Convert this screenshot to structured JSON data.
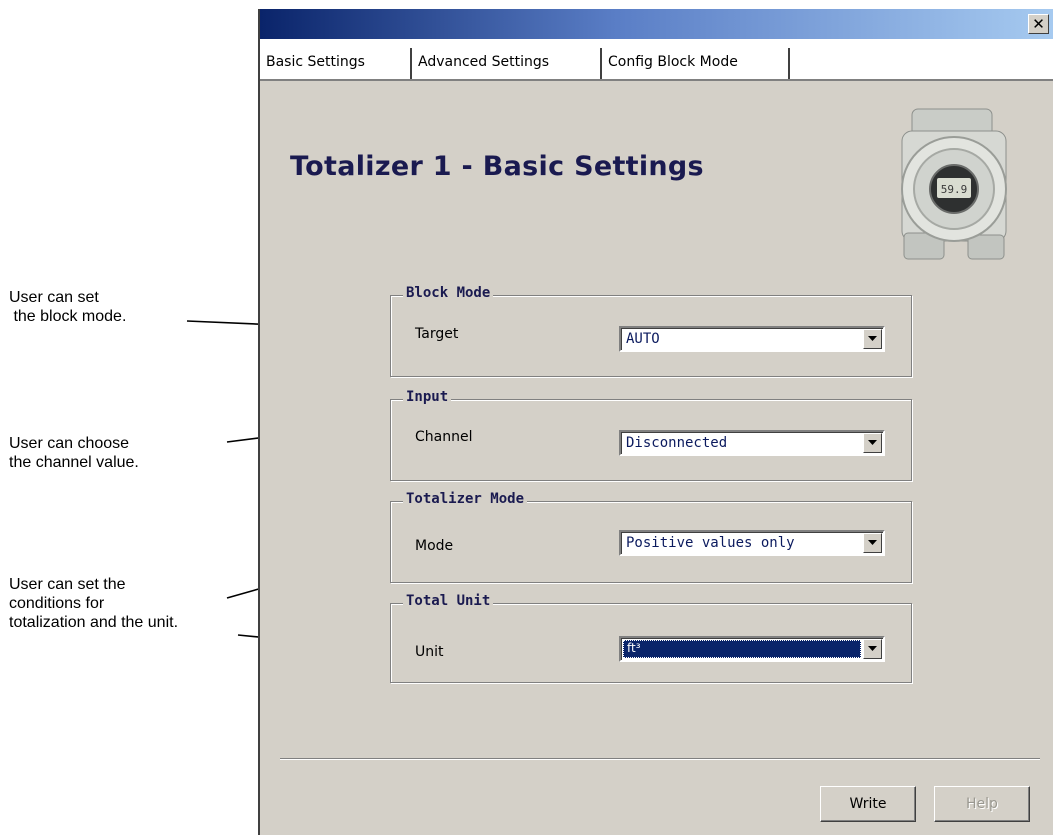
{
  "annotations": {
    "block_mode": "User can set\n the block mode.",
    "channel": "User can choose\nthe channel value.",
    "totalization": "User can set the\nconditions for\ntotalization and the unit."
  },
  "window": {
    "close_glyph": "✕"
  },
  "tabs": [
    {
      "label": "Basic Settings",
      "active": true
    },
    {
      "label": "Advanced Settings",
      "active": false
    },
    {
      "label": "Config Block Mode",
      "active": false
    }
  ],
  "page_title": "Totalizer 1 - Basic Settings",
  "device_display": "59.9",
  "groups": {
    "block_mode": {
      "title": "Block Mode",
      "label": "Target",
      "value": "AUTO"
    },
    "input": {
      "title": "Input",
      "label": "Channel",
      "value": "Disconnected"
    },
    "totalizer_mode": {
      "title": "Totalizer Mode",
      "label": "Mode",
      "value": "Positive values only"
    },
    "total_unit": {
      "title": "Total Unit",
      "label": "Unit",
      "value": "ft³"
    }
  },
  "buttons": {
    "write": "Write",
    "help": "Help"
  },
  "colors": {
    "panel": "#d4d0c8",
    "title_text": "#1a1a50",
    "selection": "#0a246a"
  }
}
